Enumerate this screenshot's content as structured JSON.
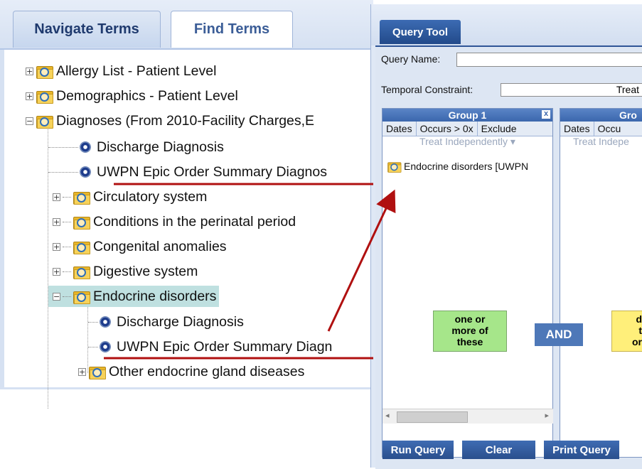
{
  "left_panel": {
    "tabs": {
      "navigate": "Navigate Terms",
      "find": "Find Terms"
    },
    "tree": {
      "allergy": "Allergy List - Patient Level",
      "demographics": "Demographics - Patient Level",
      "diagnoses": "Diagnoses (From 2010-Facility Charges,E",
      "discharge_dx_1": "Discharge Diagnosis",
      "uwpn_1": "UWPN Epic Order Summary Diagnos",
      "circulatory": "Circulatory system",
      "perinatal": "Conditions in the perinatal period",
      "congenital": "Congenital anomalies",
      "digestive": "Digestive system",
      "endocrine": "Endocrine disorders",
      "discharge_dx_2": "Discharge Diagnosis",
      "uwpn_2": "UWPN Epic Order Summary Diagn",
      "other_endocrine": "Other endocrine gland diseases"
    }
  },
  "query_tool": {
    "tab_title": "Query Tool",
    "query_name_label": "Query Name:",
    "query_name_value": "",
    "temporal_label": "Temporal Constraint:",
    "temporal_value": "Treat",
    "group1": {
      "title": "Group 1",
      "close_glyph": "x",
      "buttons": {
        "dates": "Dates",
        "occurs": "Occurs > 0x",
        "exclude": "Exclude"
      },
      "treat": "Treat Independently ▾",
      "item": "Endocrine disorders [UWPN",
      "note": [
        "one or",
        "more of",
        "these"
      ]
    },
    "group2": {
      "title": "Gro",
      "buttons": {
        "dates": "Dates",
        "occurs": "Occu"
      },
      "treat": "Treat Indepe",
      "note": [
        "d",
        "t",
        "or"
      ]
    },
    "and_label": "AND",
    "footer": {
      "run": "Run Query",
      "clear": "Clear",
      "print": "Print Query"
    }
  },
  "colors": {
    "accent_dark_blue": "#2f5597",
    "arrow_red": "#b01010",
    "note_green": "#a6e68a",
    "note_yellow": "#ffef7a",
    "selected_teal": "#bfe0e0"
  }
}
